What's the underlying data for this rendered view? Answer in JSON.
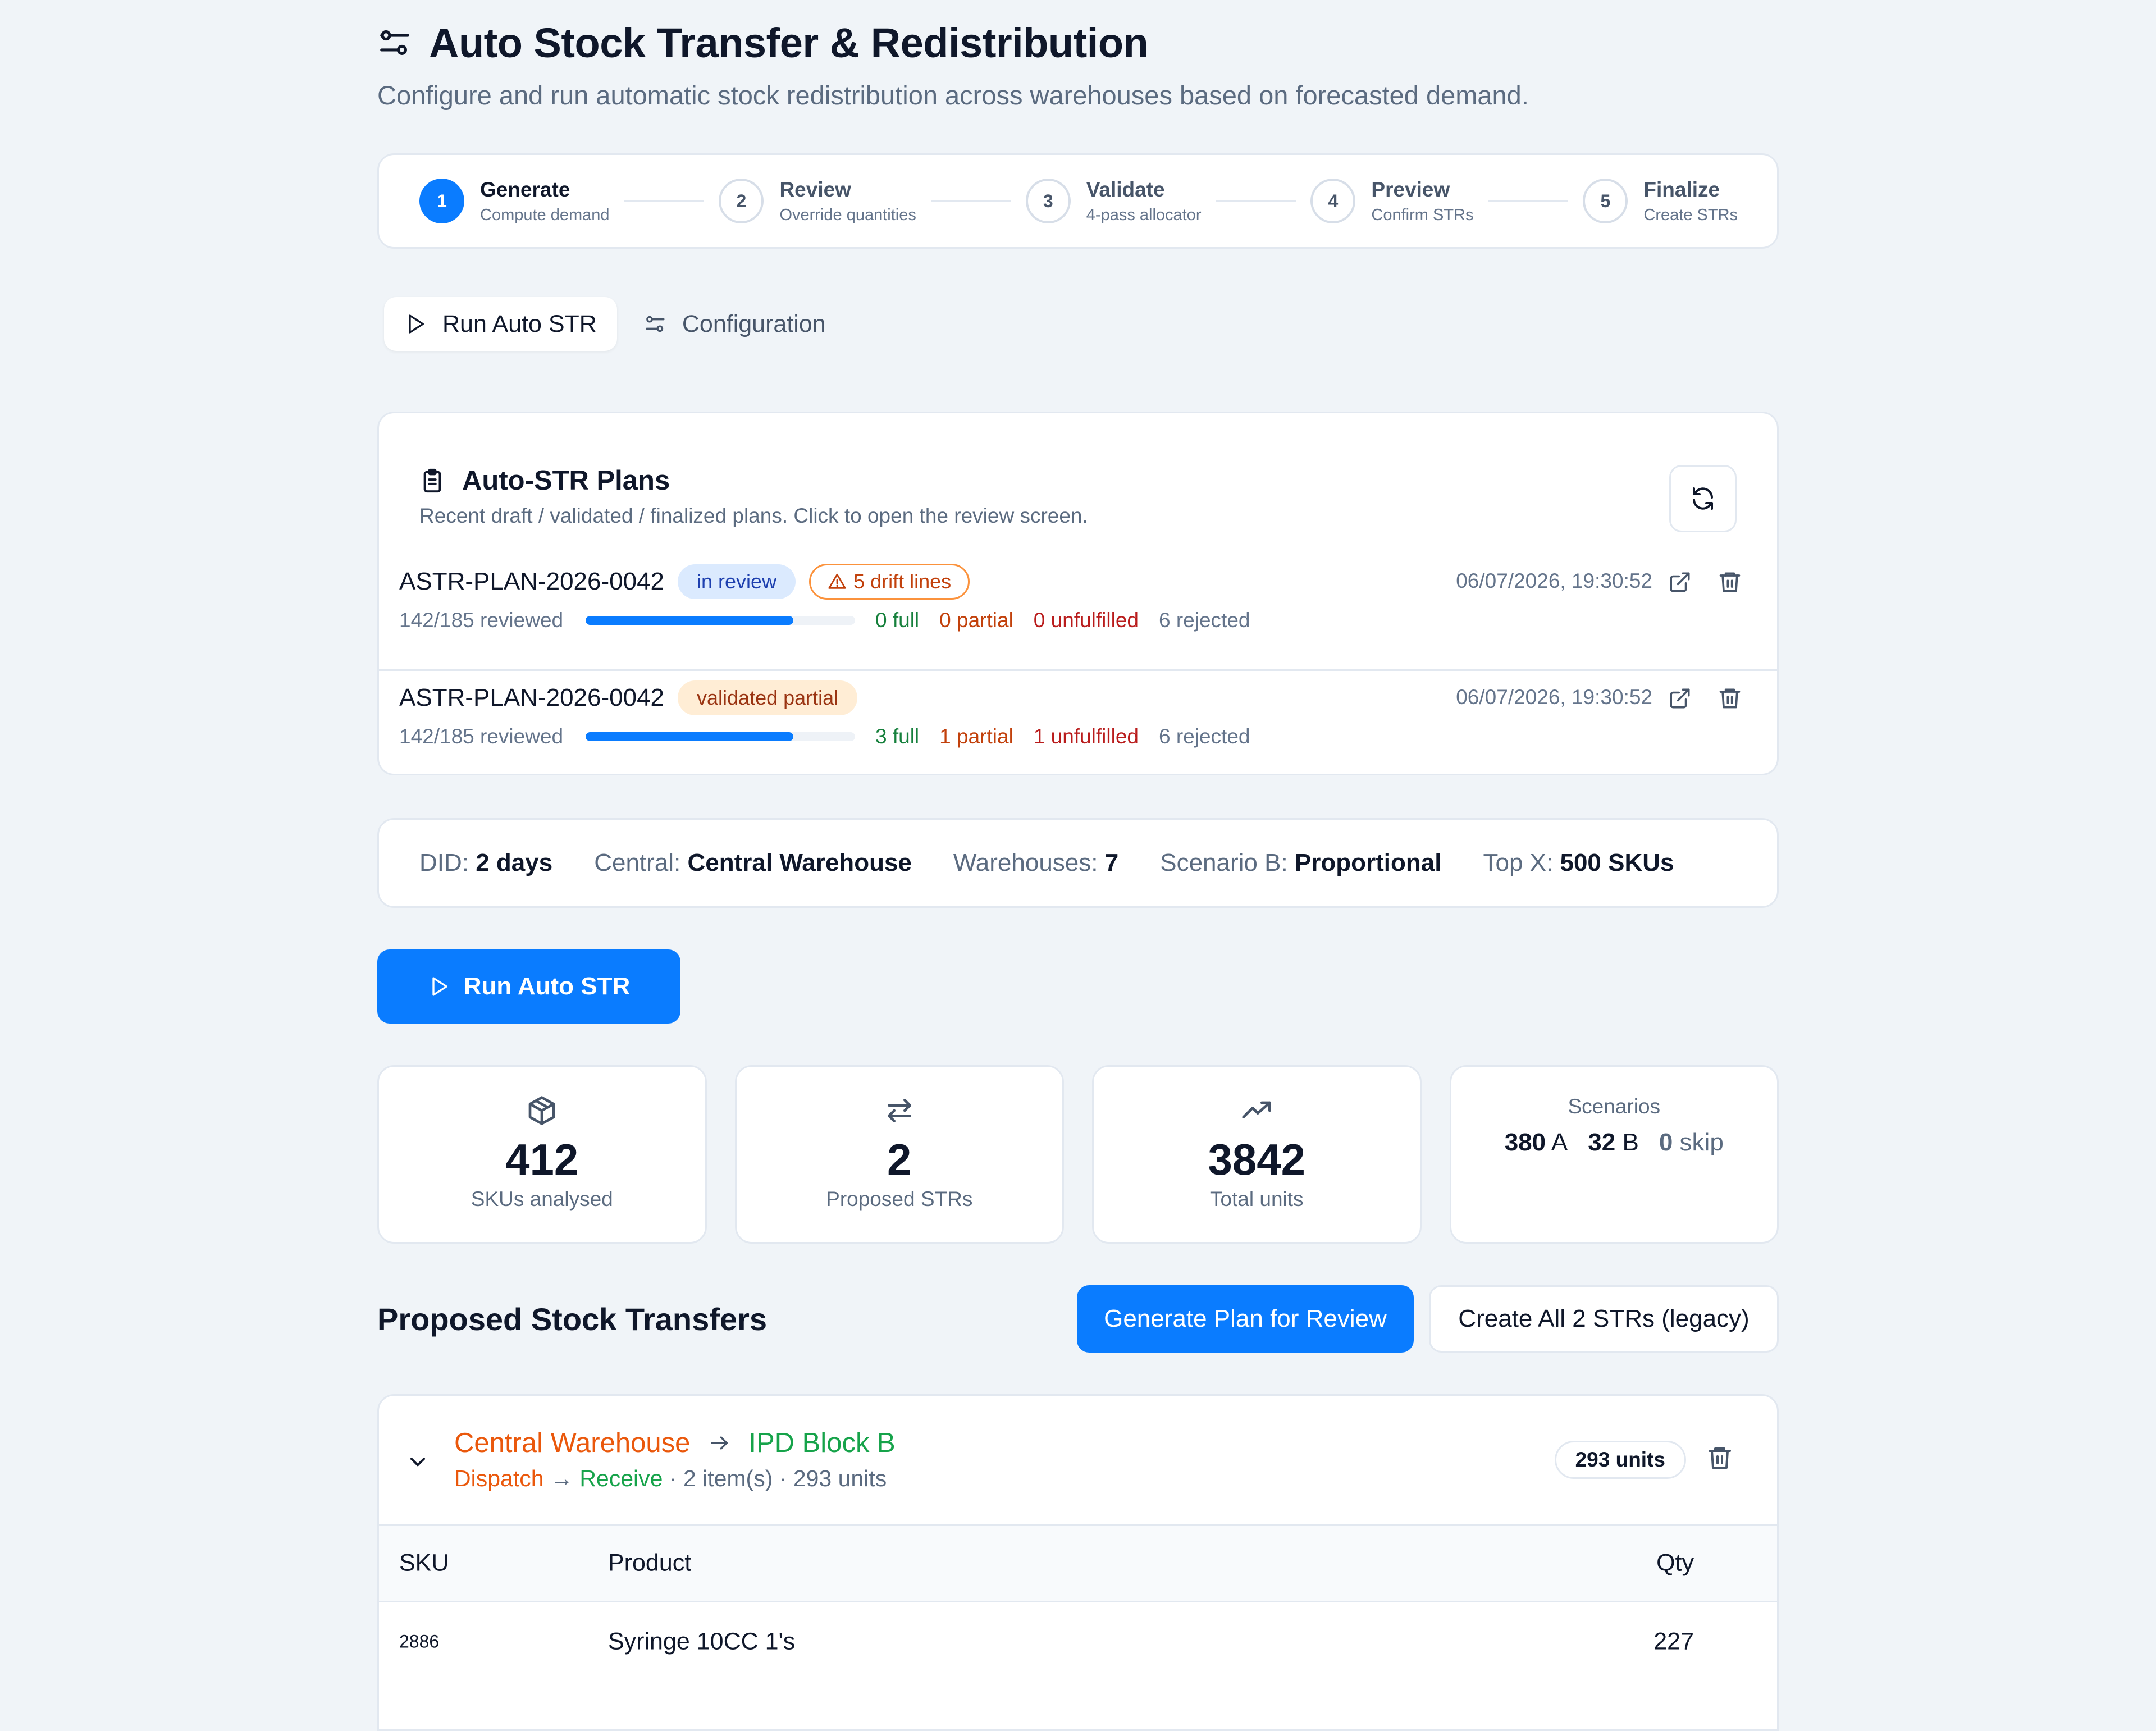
{
  "page": {
    "title": "Auto Stock Transfer & Redistribution",
    "subtitle": "Configure and run automatic stock redistribution across warehouses based on forecasted demand."
  },
  "stepper": [
    {
      "num": "1",
      "title": "Generate",
      "desc": "Compute demand",
      "active": true
    },
    {
      "num": "2",
      "title": "Review",
      "desc": "Override quantities"
    },
    {
      "num": "3",
      "title": "Validate",
      "desc": "4-pass allocator"
    },
    {
      "num": "4",
      "title": "Preview",
      "desc": "Confirm STRs"
    },
    {
      "num": "5",
      "title": "Finalize",
      "desc": "Create STRs"
    }
  ],
  "tabs": [
    {
      "label": "Run Auto STR",
      "active": true
    },
    {
      "label": "Configuration"
    }
  ],
  "plans": {
    "title": "Auto-STR Plans",
    "subtitle": "Recent draft / validated / finalized plans. Click to open the review screen.",
    "rows": [
      {
        "id": "ASTR-PLAN-2026-0042",
        "status": "in review",
        "drift": "5 drift lines",
        "date": "06/07/2026, 19:30:52",
        "reviewed": "142/185 reviewed",
        "progress": 0.77,
        "full": "0 full",
        "partial": "0 partial",
        "unfulfilled": "0 unfulfilled",
        "rejected": "6 rejected"
      },
      {
        "id": "ASTR-PLAN-2026-0042",
        "status": "validated partial",
        "date": "06/07/2026, 19:30:52",
        "reviewed": "142/185 reviewed",
        "progress": 0.77,
        "full": "3 full",
        "partial": "1 partial",
        "unfulfilled": "1 unfulfilled",
        "rejected": "6 rejected"
      }
    ]
  },
  "config": {
    "did_label": "DID:",
    "did_value": "2 days",
    "central_label": "Central:",
    "central_value": "Central Warehouse",
    "wh_label": "Warehouses:",
    "wh_value": "7",
    "scen_label": "Scenario B:",
    "scen_value": "Proportional",
    "topx_label": "Top X:",
    "topx_value": "500 SKUs"
  },
  "run_button": "Run Auto STR",
  "stats": {
    "skus_value": "412",
    "skus_label": "SKUs analysed",
    "strs_value": "2",
    "strs_label": "Proposed STRs",
    "units_value": "3842",
    "units_label": "Total units",
    "scenarios_label": "Scenarios",
    "scen_a_value": "380",
    "scen_a_label": "A",
    "scen_b_value": "32",
    "scen_b_label": "B",
    "scen_skip_value": "0",
    "scen_skip_label": "skip"
  },
  "proposed": {
    "title": "Proposed Stock Transfers",
    "generate_label": "Generate Plan for Review",
    "create_all_label": "Create All 2 STRs (legacy)"
  },
  "transfer": {
    "from": "Central Warehouse",
    "to": "IPD Block B",
    "dispatch": "Dispatch",
    "arrow": "→",
    "receive": "Receive",
    "details": "· 2 item(s) · 293 units",
    "units_badge": "293 units",
    "columns": {
      "sku": "SKU",
      "product": "Product",
      "qty": "Qty"
    },
    "rows": [
      {
        "sku": "2886",
        "product": "Syringe 10CC 1's",
        "qty": "227"
      }
    ]
  },
  "colors": {
    "primary": "#0a7cff",
    "from": "#ea580c",
    "to": "#16a34a",
    "unfulfilled": "#b91c1c"
  },
  "icons": {
    "title": "sliders-icon",
    "tab_run": "play-icon",
    "tab_config": "sliders-icon",
    "plans": "clipboard-icon",
    "refresh": "refresh-icon",
    "drift": "warning-icon",
    "open": "external-link-icon",
    "delete": "trash-icon",
    "skus": "package-icon",
    "strs": "transfer-arrows-icon",
    "units": "trending-up-icon",
    "collapse": "chevron-down-icon",
    "route": "arrow-right-icon"
  }
}
